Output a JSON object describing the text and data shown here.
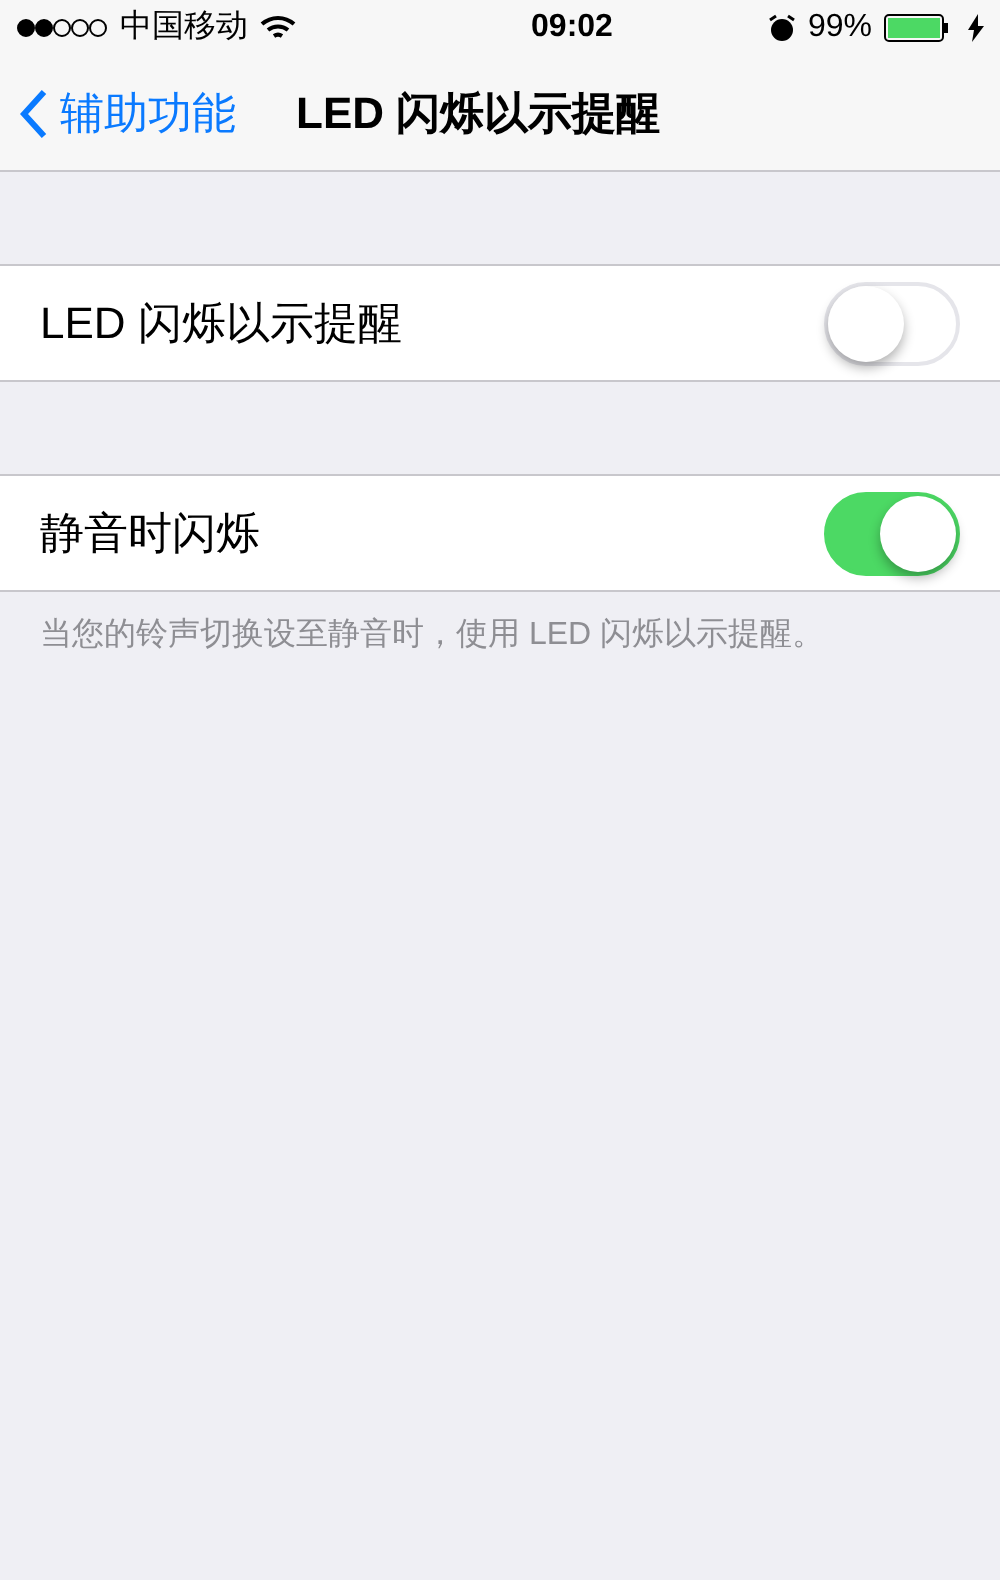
{
  "status_bar": {
    "carrier": "中国移动",
    "time": "09:02",
    "battery": "99%"
  },
  "nav": {
    "back": "辅助功能",
    "title": "LED 闪烁以示提醒"
  },
  "sections": [
    {
      "rows": [
        {
          "label": "LED 闪烁以示提醒",
          "on": false
        }
      ]
    },
    {
      "rows": [
        {
          "label": "静音时闪烁",
          "on": true
        }
      ],
      "footer": "当您的铃声切换设至静音时，使用 LED 闪烁以示提醒。"
    }
  ]
}
